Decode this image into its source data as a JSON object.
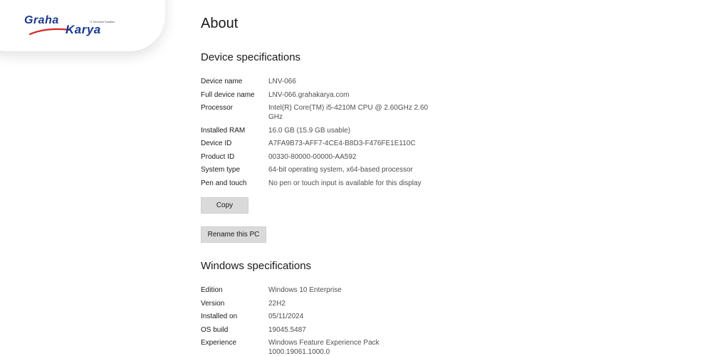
{
  "brand": {
    "name_part1": "Graha",
    "name_part2": "Karya",
    "tagline": "IT Services Solution",
    "color": "#1a3a8f",
    "accent": "#d62828"
  },
  "page": {
    "title": "About"
  },
  "device_specs": {
    "title": "Device specifications",
    "rows": [
      {
        "label": "Device name",
        "value": "LNV-066"
      },
      {
        "label": "Full device name",
        "value": "LNV-066.grahakarya.com"
      },
      {
        "label": "Processor",
        "value": "Intel(R) Core(TM) i5-4210M CPU @ 2.60GHz   2.60 GHz"
      },
      {
        "label": "Installed RAM",
        "value": "16.0 GB (15.9 GB usable)"
      },
      {
        "label": "Device ID",
        "value": "A7FA9B73-AFF7-4CE4-B8D3-F476FE1E110C"
      },
      {
        "label": "Product ID",
        "value": "00330-80000-00000-AA592"
      },
      {
        "label": "System type",
        "value": "64-bit operating system, x64-based processor"
      },
      {
        "label": "Pen and touch",
        "value": "No pen or touch input is available for this display"
      }
    ],
    "copy_label": "Copy",
    "rename_label": "Rename this PC"
  },
  "windows_specs": {
    "title": "Windows specifications",
    "rows": [
      {
        "label": "Edition",
        "value": "Windows 10 Enterprise"
      },
      {
        "label": "Version",
        "value": "22H2"
      },
      {
        "label": "Installed on",
        "value": "05/11/2024"
      },
      {
        "label": "OS build",
        "value": "19045.5487"
      },
      {
        "label": "Experience",
        "value": "Windows Feature Experience Pack 1000.19061.1000.0"
      }
    ]
  }
}
